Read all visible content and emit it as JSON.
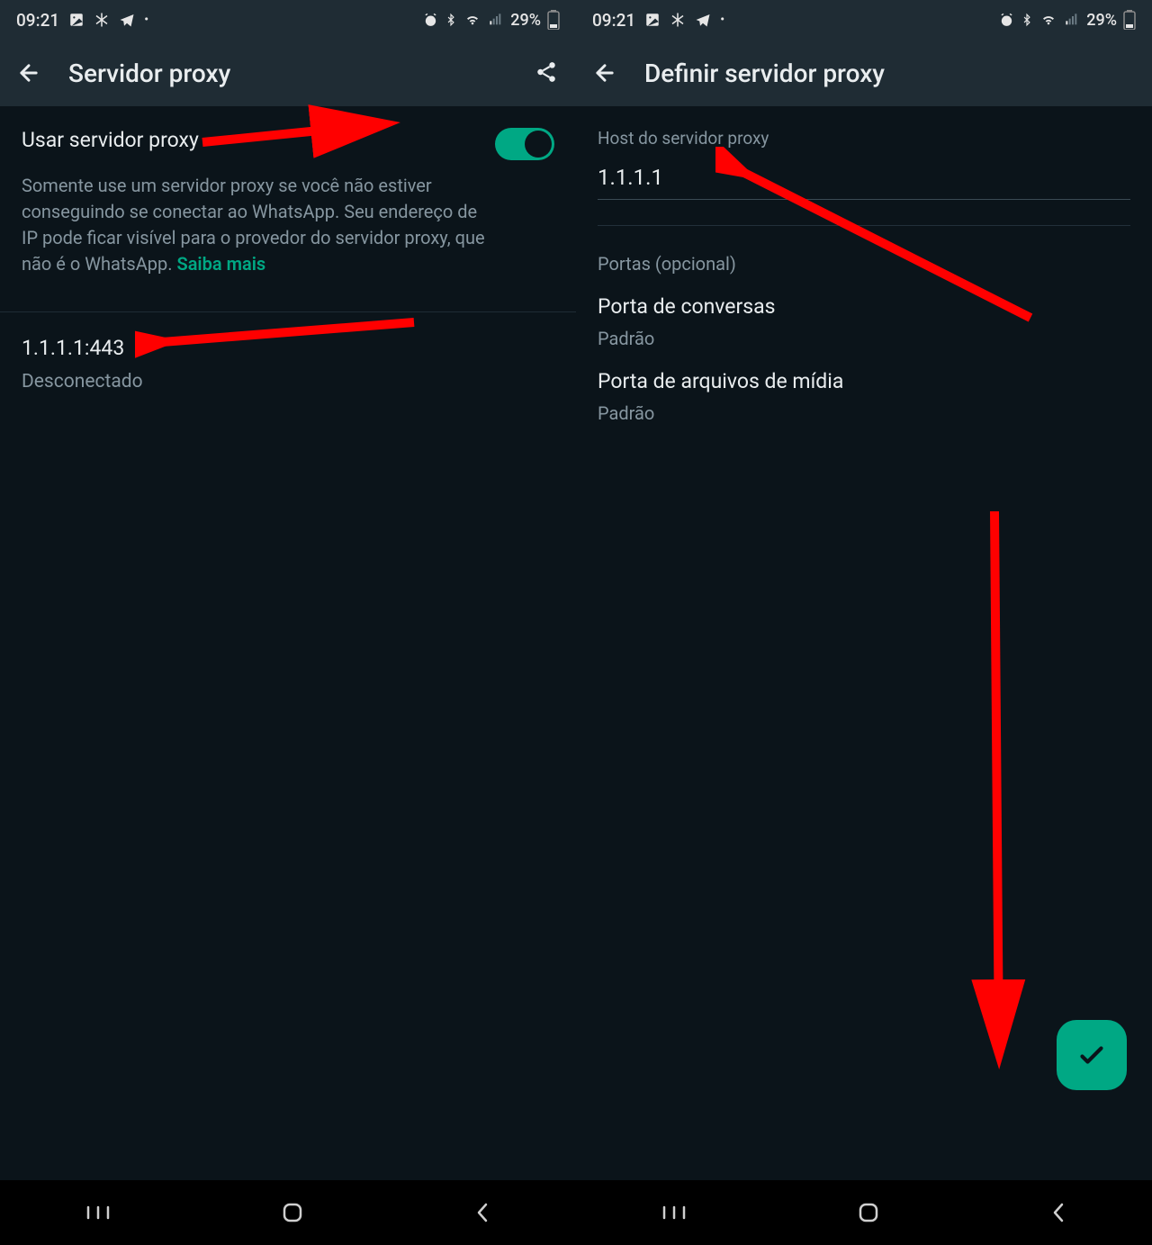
{
  "status_bar": {
    "time": "09:21",
    "battery": "29%"
  },
  "left": {
    "header_title": "Servidor proxy",
    "toggle_label": "Usar servidor proxy",
    "description": "Somente use um servidor proxy se você não estiver conseguindo se conectar ao WhatsApp. Seu endereço de IP pode ficar visível para o provedor do servidor proxy, que não é o WhatsApp. ",
    "learn_more": "Saiba mais",
    "proxy_address": "1.1.1.1:443",
    "proxy_status": "Desconectado"
  },
  "right": {
    "header_title": "Definir servidor proxy",
    "host_label": "Host do servidor proxy",
    "host_value": "1.1.1.1",
    "ports_section": "Portas (opcional)",
    "chat_port_title": "Porta de conversas",
    "chat_port_value": "Padrão",
    "media_port_title": "Porta de arquivos de mídia",
    "media_port_value": "Padrão"
  }
}
